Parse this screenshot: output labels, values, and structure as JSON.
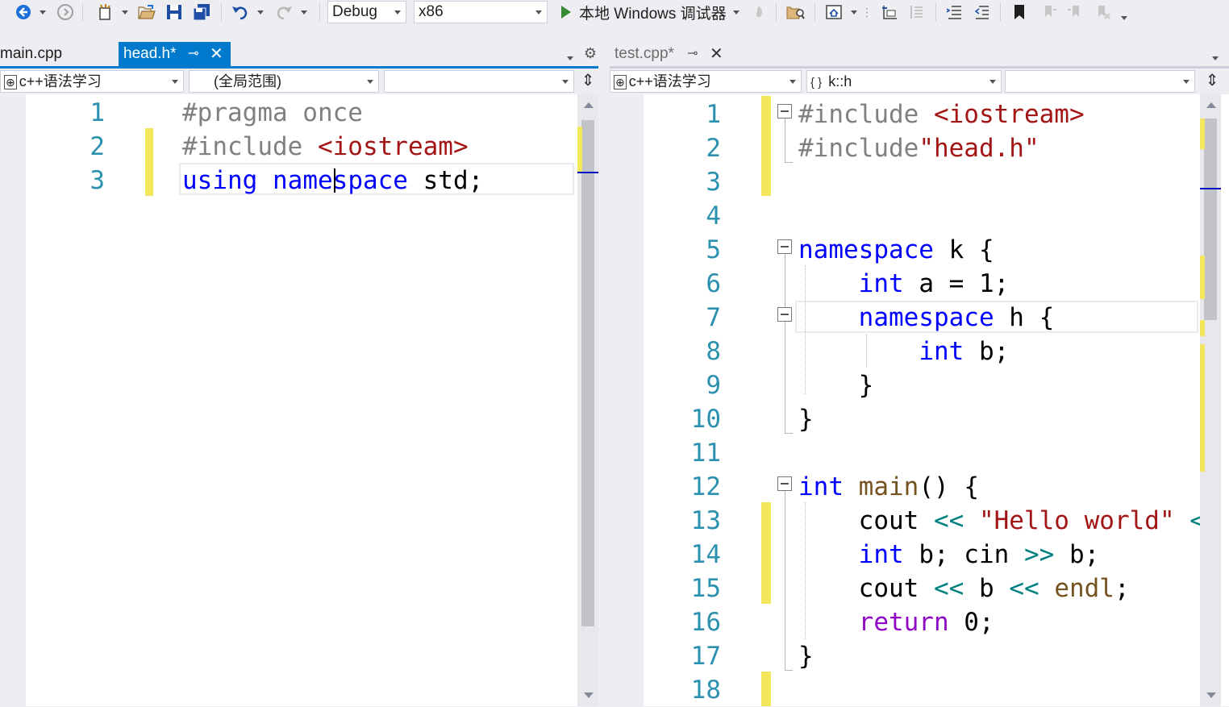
{
  "toolbar": {
    "config": "Debug",
    "platform": "x86",
    "run_label": "本地 Windows 调试器",
    "icons": [
      "back-icon",
      "forward-icon",
      "new-project-icon",
      "open-folder-icon",
      "save-icon",
      "save-all-icon",
      "undo-icon",
      "redo-icon",
      "fire-icon",
      "find-in-files-icon",
      "home-icon",
      "step-icon",
      "outline-icon",
      "indent-icon",
      "outdent-icon",
      "bookmark-icon",
      "prev-bookmark-icon",
      "next-bookmark-icon",
      "clear-bookmarks-icon"
    ]
  },
  "left_pane": {
    "tabs": [
      {
        "label": "main.cpp",
        "active": false
      },
      {
        "label": "head.h*",
        "active": true
      }
    ],
    "nav": {
      "project": "c++语法学习",
      "scope": "(全局范围)",
      "member": ""
    },
    "line_numbers": [
      "1",
      "2",
      "3"
    ],
    "lines": [
      [
        {
          "t": "#pragma once",
          "c": "pp"
        }
      ],
      [
        {
          "t": "#include ",
          "c": "pp"
        },
        {
          "t": "<iostream>",
          "c": "str"
        }
      ],
      [
        {
          "t": "using",
          "c": "kw"
        },
        {
          "t": " "
        },
        {
          "t": "namespace",
          "c": "kw"
        },
        {
          "t": " std;"
        }
      ]
    ]
  },
  "right_pane": {
    "tabs": [
      {
        "label": "test.cpp*",
        "active": false
      }
    ],
    "nav": {
      "project": "c++语法学习",
      "scope": "k::h",
      "member": ""
    },
    "line_numbers": [
      "1",
      "2",
      "3",
      "4",
      "5",
      "6",
      "7",
      "8",
      "9",
      "10",
      "11",
      "12",
      "13",
      "14",
      "15",
      "16",
      "17",
      "18"
    ],
    "lines": [
      [
        {
          "t": "#include ",
          "c": "pp"
        },
        {
          "t": "<iostream>",
          "c": "str"
        }
      ],
      [
        {
          "t": "#include",
          "c": "pp"
        },
        {
          "t": "\"head.h\"",
          "c": "str"
        }
      ],
      [],
      [],
      [
        {
          "t": "namespace",
          "c": "kw"
        },
        {
          "t": " k {"
        }
      ],
      [
        {
          "t": "    "
        },
        {
          "t": "int",
          "c": "kw"
        },
        {
          "t": " a = 1;"
        }
      ],
      [
        {
          "t": "    "
        },
        {
          "t": "namespace",
          "c": "kw"
        },
        {
          "t": " h {"
        }
      ],
      [
        {
          "t": "        "
        },
        {
          "t": "int",
          "c": "kw"
        },
        {
          "t": " b;"
        }
      ],
      [
        {
          "t": "    }"
        }
      ],
      [
        {
          "t": "}"
        }
      ],
      [],
      [
        {
          "t": "int",
          "c": "kw"
        },
        {
          "t": " "
        },
        {
          "t": "main",
          "c": "fn"
        },
        {
          "t": "() {"
        }
      ],
      [
        {
          "t": "    cout "
        },
        {
          "t": "<<",
          "c": "op"
        },
        {
          "t": " "
        },
        {
          "t": "\"Hello world\"",
          "c": "str"
        },
        {
          "t": " "
        },
        {
          "t": "<",
          "c": "op"
        }
      ],
      [
        {
          "t": "    "
        },
        {
          "t": "int",
          "c": "kw"
        },
        {
          "t": " b; cin "
        },
        {
          "t": ">>",
          "c": "op"
        },
        {
          "t": " b;"
        }
      ],
      [
        {
          "t": "    cout "
        },
        {
          "t": "<<",
          "c": "op"
        },
        {
          "t": " b "
        },
        {
          "t": "<<",
          "c": "op"
        },
        {
          "t": " "
        },
        {
          "t": "endl",
          "c": "fn"
        },
        {
          "t": ";"
        }
      ],
      [
        {
          "t": "    "
        },
        {
          "t": "return",
          "c": "ctl"
        },
        {
          "t": " 0;"
        }
      ],
      [
        {
          "t": "}"
        }
      ],
      []
    ]
  }
}
